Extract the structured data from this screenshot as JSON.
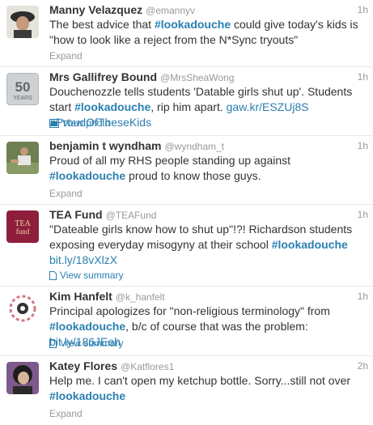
{
  "tweets": [
    {
      "name": "Manny Velazquez",
      "handle": "@emannyv",
      "time": "1h",
      "text_parts": [
        "The best advice that ",
        "#lookadouche",
        " could give today's kids is \"how to look like a reject from the N*Sync tryouts\""
      ],
      "action": "Expand"
    },
    {
      "name": "Mrs Gallifrey Bound",
      "handle": "@MrsSheaWong",
      "time": "1h",
      "avatar_text": "50",
      "avatar_sub": "YEARS",
      "text_parts": [
        "Douchenozzle tells students 'Datable girls shut up'. Students start ",
        "#lookadouche",
        ", rip him apart. ",
        "gaw.kr/ESZUj8S",
        " ",
        "#ProudOfTheseKids"
      ],
      "action": "View photo"
    },
    {
      "name": "benjamin t wyndham",
      "handle": "@wyndham_t",
      "time": "1h",
      "text_parts": [
        "Proud of all my RHS people standing up against ",
        "#lookadouche",
        " proud to know those guys."
      ],
      "action": "Expand"
    },
    {
      "name": "TEA Fund",
      "handle": "@TEAFund",
      "time": "1h",
      "avatar_text": "TEA",
      "avatar_sub": "fund",
      "text_parts": [
        "\"Dateable girls know how to shut up\"!?! Richardson students exposing everyday misogyny at their school ",
        "#lookadouche",
        " ",
        "bit.ly/18vXlzX"
      ],
      "action": "View summary"
    },
    {
      "name": "Kim Hanfelt",
      "handle": "@k_hanfelt",
      "time": "1h",
      "text_parts": [
        "Principal apologizes for \"non-religious terminology\" from ",
        "#lookadouche",
        ", b/c of course that was the problem: ",
        "bit.ly/186JEeh"
      ],
      "action": "View summary"
    },
    {
      "name": "Katey Flores",
      "handle": "@Katflores1",
      "time": "2h",
      "text_parts": [
        "Help me. I can't open my ketchup bottle. Sorry...still not over ",
        "#lookadouche"
      ],
      "action": "Expand"
    }
  ],
  "colors": {
    "link": "#2a7fb0",
    "muted": "#999999",
    "text": "#333333"
  }
}
